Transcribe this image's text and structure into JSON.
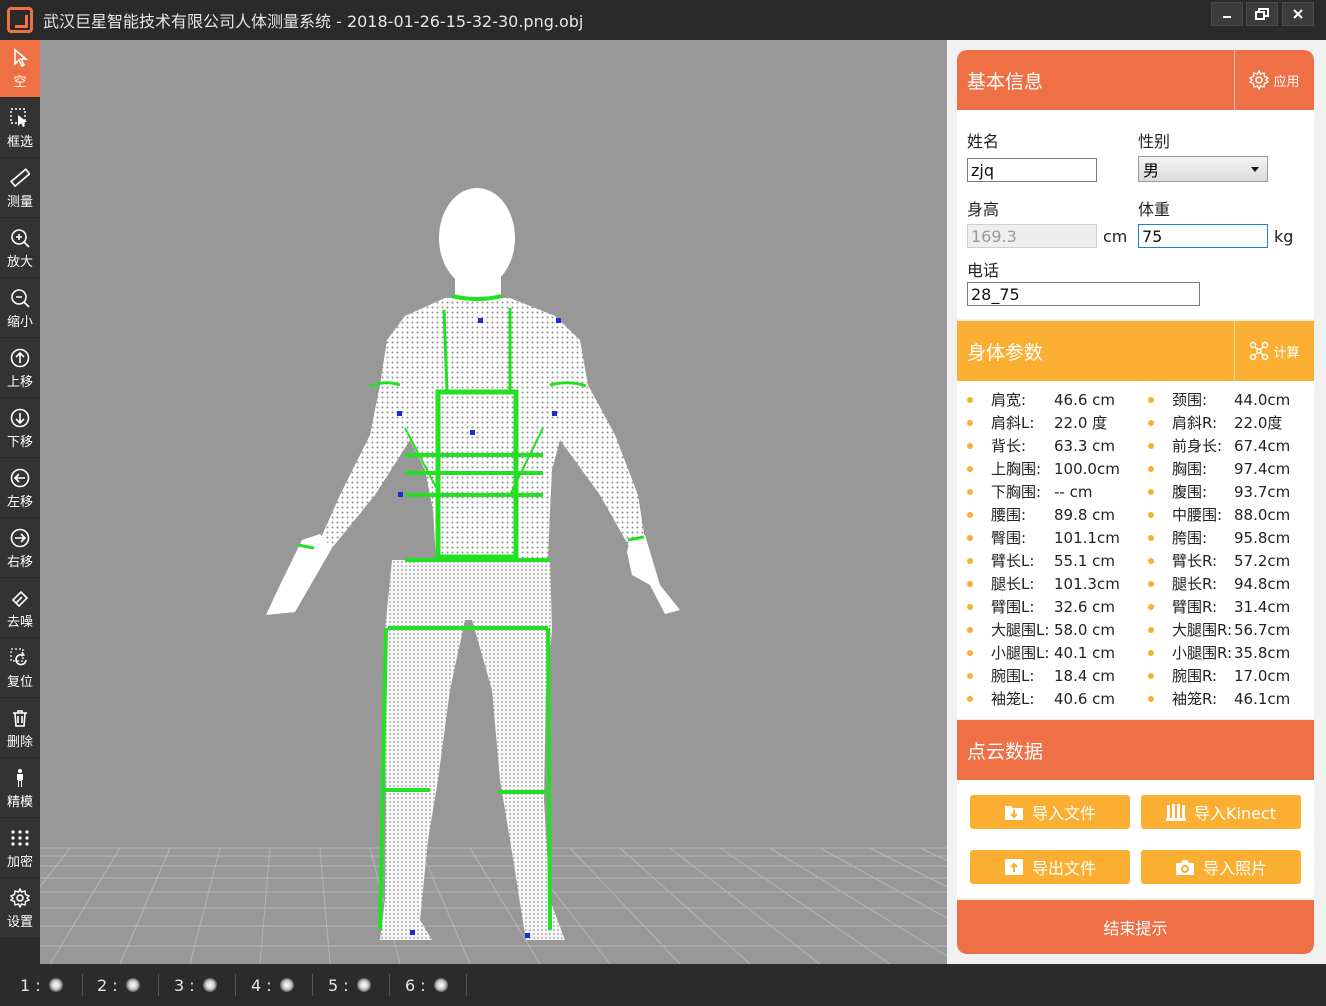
{
  "window": {
    "title": "武汉巨星智能技术有限公司人体测量系统 - 2018-01-26-15-32-30.png.obj",
    "min_icon": "minimize-icon",
    "max_icon": "restore-icon",
    "close_icon": "close-icon"
  },
  "toolbar": [
    {
      "label": "空",
      "icon": "pointer-icon",
      "active": true
    },
    {
      "label": "框选",
      "icon": "box-select-icon"
    },
    {
      "label": "测量",
      "icon": "ruler-icon"
    },
    {
      "label": "放大",
      "icon": "zoom-in-icon"
    },
    {
      "label": "缩小",
      "icon": "zoom-out-icon"
    },
    {
      "label": "上移",
      "icon": "arrow-up-icon"
    },
    {
      "label": "下移",
      "icon": "arrow-down-icon"
    },
    {
      "label": "左移",
      "icon": "arrow-left-icon"
    },
    {
      "label": "右移",
      "icon": "arrow-right-icon"
    },
    {
      "label": "去噪",
      "icon": "eraser-icon"
    },
    {
      "label": "复位",
      "icon": "reset-icon"
    },
    {
      "label": "删除",
      "icon": "trash-icon"
    },
    {
      "label": "精模",
      "icon": "human-icon"
    },
    {
      "label": "加密",
      "icon": "densify-icon"
    },
    {
      "label": "设置",
      "icon": "gear-icon"
    }
  ],
  "basic_info": {
    "title": "基本信息",
    "action_label": "应用",
    "name_label": "姓名",
    "name_value": "zjq",
    "gender_label": "性别",
    "gender_value": "男",
    "height_label": "身高",
    "height_value": "169.3",
    "height_unit": "cm",
    "weight_label": "体重",
    "weight_value": "75",
    "weight_unit": "kg",
    "phone_label": "电话",
    "phone_value": "28_75"
  },
  "body_params": {
    "title": "身体参数",
    "action_label": "计算",
    "left": [
      {
        "name": "肩宽:",
        "value": "46.6 cm"
      },
      {
        "name": "肩斜L:",
        "value": "22.0 度"
      },
      {
        "name": "背长:",
        "value": "63.3 cm"
      },
      {
        "name": "上胸围:",
        "value": "100.0cm"
      },
      {
        "name": "下胸围:",
        "value": "--   cm"
      },
      {
        "name": "腰围:",
        "value": "89.8 cm"
      },
      {
        "name": "臀围:",
        "value": "101.1cm"
      },
      {
        "name": "臂长L:",
        "value": "55.1 cm"
      },
      {
        "name": "腿长L:",
        "value": "101.3cm"
      },
      {
        "name": "臂围L:",
        "value": "32.6 cm"
      },
      {
        "name": "大腿围L:",
        "value": "58.0 cm"
      },
      {
        "name": "小腿围L:",
        "value": "40.1 cm"
      },
      {
        "name": "腕围L:",
        "value": "18.4 cm"
      },
      {
        "name": "袖笼L:",
        "value": "40.6 cm"
      }
    ],
    "right": [
      {
        "name": "颈围:",
        "value": "44.0cm"
      },
      {
        "name": "肩斜R:",
        "value": "22.0度"
      },
      {
        "name": "前身长:",
        "value": "67.4cm"
      },
      {
        "name": "胸围:",
        "value": "97.4cm"
      },
      {
        "name": "腹围:",
        "value": "93.7cm"
      },
      {
        "name": "中腰围:",
        "value": "88.0cm"
      },
      {
        "name": "胯围:",
        "value": "95.8cm"
      },
      {
        "name": "臂长R:",
        "value": "57.2cm"
      },
      {
        "name": "腿长R:",
        "value": "94.8cm"
      },
      {
        "name": "臂围R:",
        "value": "31.4cm"
      },
      {
        "name": "大腿围R:",
        "value": "56.7cm"
      },
      {
        "name": "小腿围R:",
        "value": "35.8cm"
      },
      {
        "name": "腕围R:",
        "value": "17.0cm"
      },
      {
        "name": "袖笼R:",
        "value": "46.1cm"
      }
    ]
  },
  "point_cloud": {
    "title": "点云数据",
    "import_file": "导入文件",
    "import_kinect": "导入Kinect",
    "export_file": "导出文件",
    "import_photo": "导入照片"
  },
  "finish_label": "结束提示",
  "slots": [
    "1 :",
    "2 :",
    "3 :",
    "4 :",
    "5 :",
    "6 :"
  ],
  "colors": {
    "accent_orange": "#f07045",
    "accent_yellow": "#fbaf32",
    "viewport_bg": "#989898",
    "measure_green": "#22e022"
  }
}
